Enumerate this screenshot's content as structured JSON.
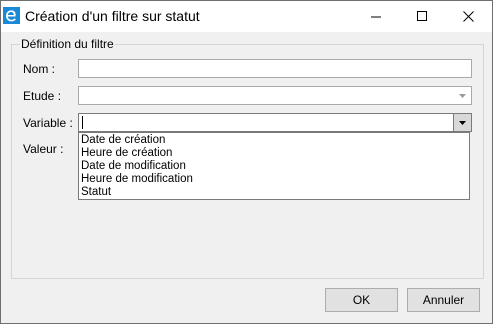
{
  "window": {
    "title": "Création d'un filtre sur statut",
    "icon": "app-e-icon",
    "controls": [
      "minimize-icon",
      "maximize-icon",
      "close-icon"
    ]
  },
  "form": {
    "group_title": "Définition du filtre",
    "nom": {
      "label": "Nom :",
      "value": ""
    },
    "etude": {
      "label": "Etude :",
      "value": ""
    },
    "variable": {
      "label": "Variable :",
      "value": "",
      "options": [
        "Date de création",
        "Heure de création",
        "Date de modification",
        "Heure de modification",
        "Statut"
      ]
    },
    "valeur": {
      "label": "Valeur :"
    }
  },
  "buttons": {
    "ok": "OK",
    "cancel": "Annuler"
  },
  "colors": {
    "app_icon": "#1a8ad6",
    "background": "#f0f0f0",
    "button_face": "#e1e1e1"
  }
}
